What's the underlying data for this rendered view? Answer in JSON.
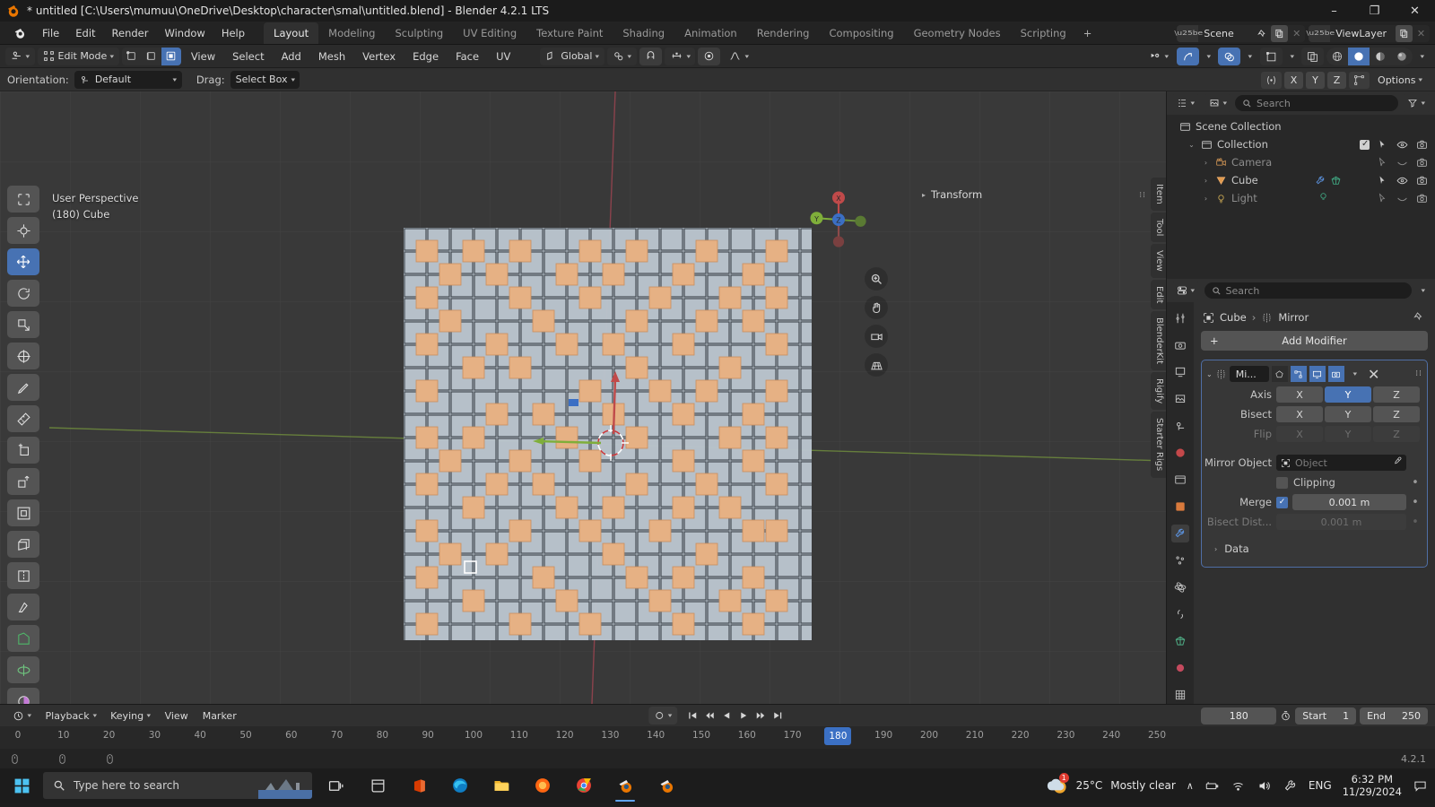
{
  "window": {
    "title": "* untitled [C:\\Users\\mumuu\\OneDrive\\Desktop\\character\\smal\\untitled.blend] - Blender 4.2.1 LTS",
    "minimize": "–",
    "maximize": "❐",
    "close": "✕"
  },
  "topbar": {
    "menus": [
      "File",
      "Edit",
      "Render",
      "Window",
      "Help"
    ],
    "workspaces": [
      "Layout",
      "Modeling",
      "Sculpting",
      "UV Editing",
      "Texture Paint",
      "Shading",
      "Animation",
      "Rendering",
      "Compositing",
      "Geometry Nodes",
      "Scripting"
    ],
    "active_workspace": "Layout",
    "add_workspace": "+",
    "scene_name": "Scene",
    "viewlayer_name": "ViewLayer"
  },
  "viewport_header": {
    "mode": "Edit Mode",
    "menus": [
      "View",
      "Select",
      "Add",
      "Mesh",
      "Vertex",
      "Edge",
      "Face",
      "UV"
    ],
    "transform_orientation": "Global",
    "select_mode_active": "face"
  },
  "tool_row": {
    "orientation_label": "Orientation:",
    "orientation_value": "Default",
    "drag_label": "Drag:",
    "drag_value": "Select Box",
    "proportional_axes": [
      "X",
      "Y",
      "Z"
    ],
    "options_label": "Options"
  },
  "viewport": {
    "perspective_text": "User Perspective",
    "object_text": "(180) Cube",
    "gizmo_axes": {
      "x": "X",
      "y": "Y",
      "z": "Z"
    },
    "transform_panel_title": "Transform",
    "side_tabs": [
      "Item",
      "Tool",
      "View",
      "Edit",
      "BlenderKit",
      "Rigify",
      "Starter Rigs"
    ],
    "tools": [
      "tweak-tool",
      "cursor-tool",
      "move-tool",
      "rotate-tool",
      "scale-tool",
      "transform-tool",
      "annotate-tool",
      "measure-tool",
      "add-cube-tool",
      "extrude-tool",
      "inset-tool",
      "bevel-tool",
      "loop-cut-tool",
      "knife-tool",
      "poly-build-tool",
      "spin-tool",
      "smooth-tool",
      "shrink-fatten-tool"
    ]
  },
  "outliner": {
    "search_placeholder": "Search",
    "rows": [
      {
        "label": "Scene Collection",
        "indent": 0,
        "icon": "collection-icon",
        "expand": "",
        "dim": false
      },
      {
        "label": "Collection",
        "indent": 1,
        "icon": "collection-icon",
        "expand": "⌄",
        "dim": false
      },
      {
        "label": "Camera",
        "indent": 2,
        "icon": "camera-icon",
        "expand": "›",
        "dim": true
      },
      {
        "label": "Cube",
        "indent": 2,
        "icon": "mesh-icon",
        "expand": "›",
        "dim": false
      },
      {
        "label": "Light",
        "indent": 2,
        "icon": "light-icon",
        "expand": "›",
        "dim": true
      }
    ]
  },
  "properties": {
    "search_placeholder": "Search",
    "breadcrumb_object": "Cube",
    "breadcrumb_sep": "›",
    "breadcrumb_modifier": "Mirror",
    "add_modifier_label": "Add Modifier",
    "add_modifier_plus": "+",
    "modifier": {
      "name": "Mi...",
      "axis_label": "Axis",
      "axis_options": [
        "X",
        "Y",
        "Z"
      ],
      "axis_active": "Y",
      "bisect_label": "Bisect",
      "bisect_options": [
        "X",
        "Y",
        "Z"
      ],
      "flip_label": "Flip",
      "flip_options": [
        "X",
        "Y",
        "Z"
      ],
      "mirror_object_label": "Mirror Object",
      "mirror_object_value": "Object",
      "clipping_label": "Clipping",
      "clipping_checked": false,
      "merge_label": "Merge",
      "merge_checked": true,
      "merge_value": "0.001 m",
      "bisect_dist_label": "Bisect Dist...",
      "bisect_dist_value": "0.001 m",
      "data_label": "Data",
      "data_arrow": "›"
    }
  },
  "timeline": {
    "menus": [
      "Playback",
      "Keying",
      "View",
      "Marker"
    ],
    "current_frame": "180",
    "start_label": "Start",
    "start_value": "1",
    "end_label": "End",
    "end_value": "250",
    "ticks": [
      "0",
      "10",
      "20",
      "30",
      "40",
      "50",
      "60",
      "70",
      "80",
      "90",
      "100",
      "110",
      "120",
      "130",
      "140",
      "150",
      "160",
      "170",
      "180",
      "190",
      "200",
      "210",
      "220",
      "230",
      "240",
      "250"
    ],
    "playhead_frame": "180"
  },
  "statusbar": {
    "version": "4.2.1"
  },
  "taskbar": {
    "search_placeholder": "Type here to search",
    "weather_temp": "25°C",
    "weather_desc": "Mostly clear",
    "lang": "ENG",
    "time": "6:32 PM",
    "date": "11/29/2024",
    "overflow_arrow": "∧"
  },
  "colors": {
    "accent_blue": "#4772b3",
    "axis_x": "#c04a4a",
    "axis_y": "#7fae3a",
    "axis_z": "#3b6fc4",
    "mesh_selected": "#e6b184",
    "mesh_base": "#b9c3cc"
  }
}
